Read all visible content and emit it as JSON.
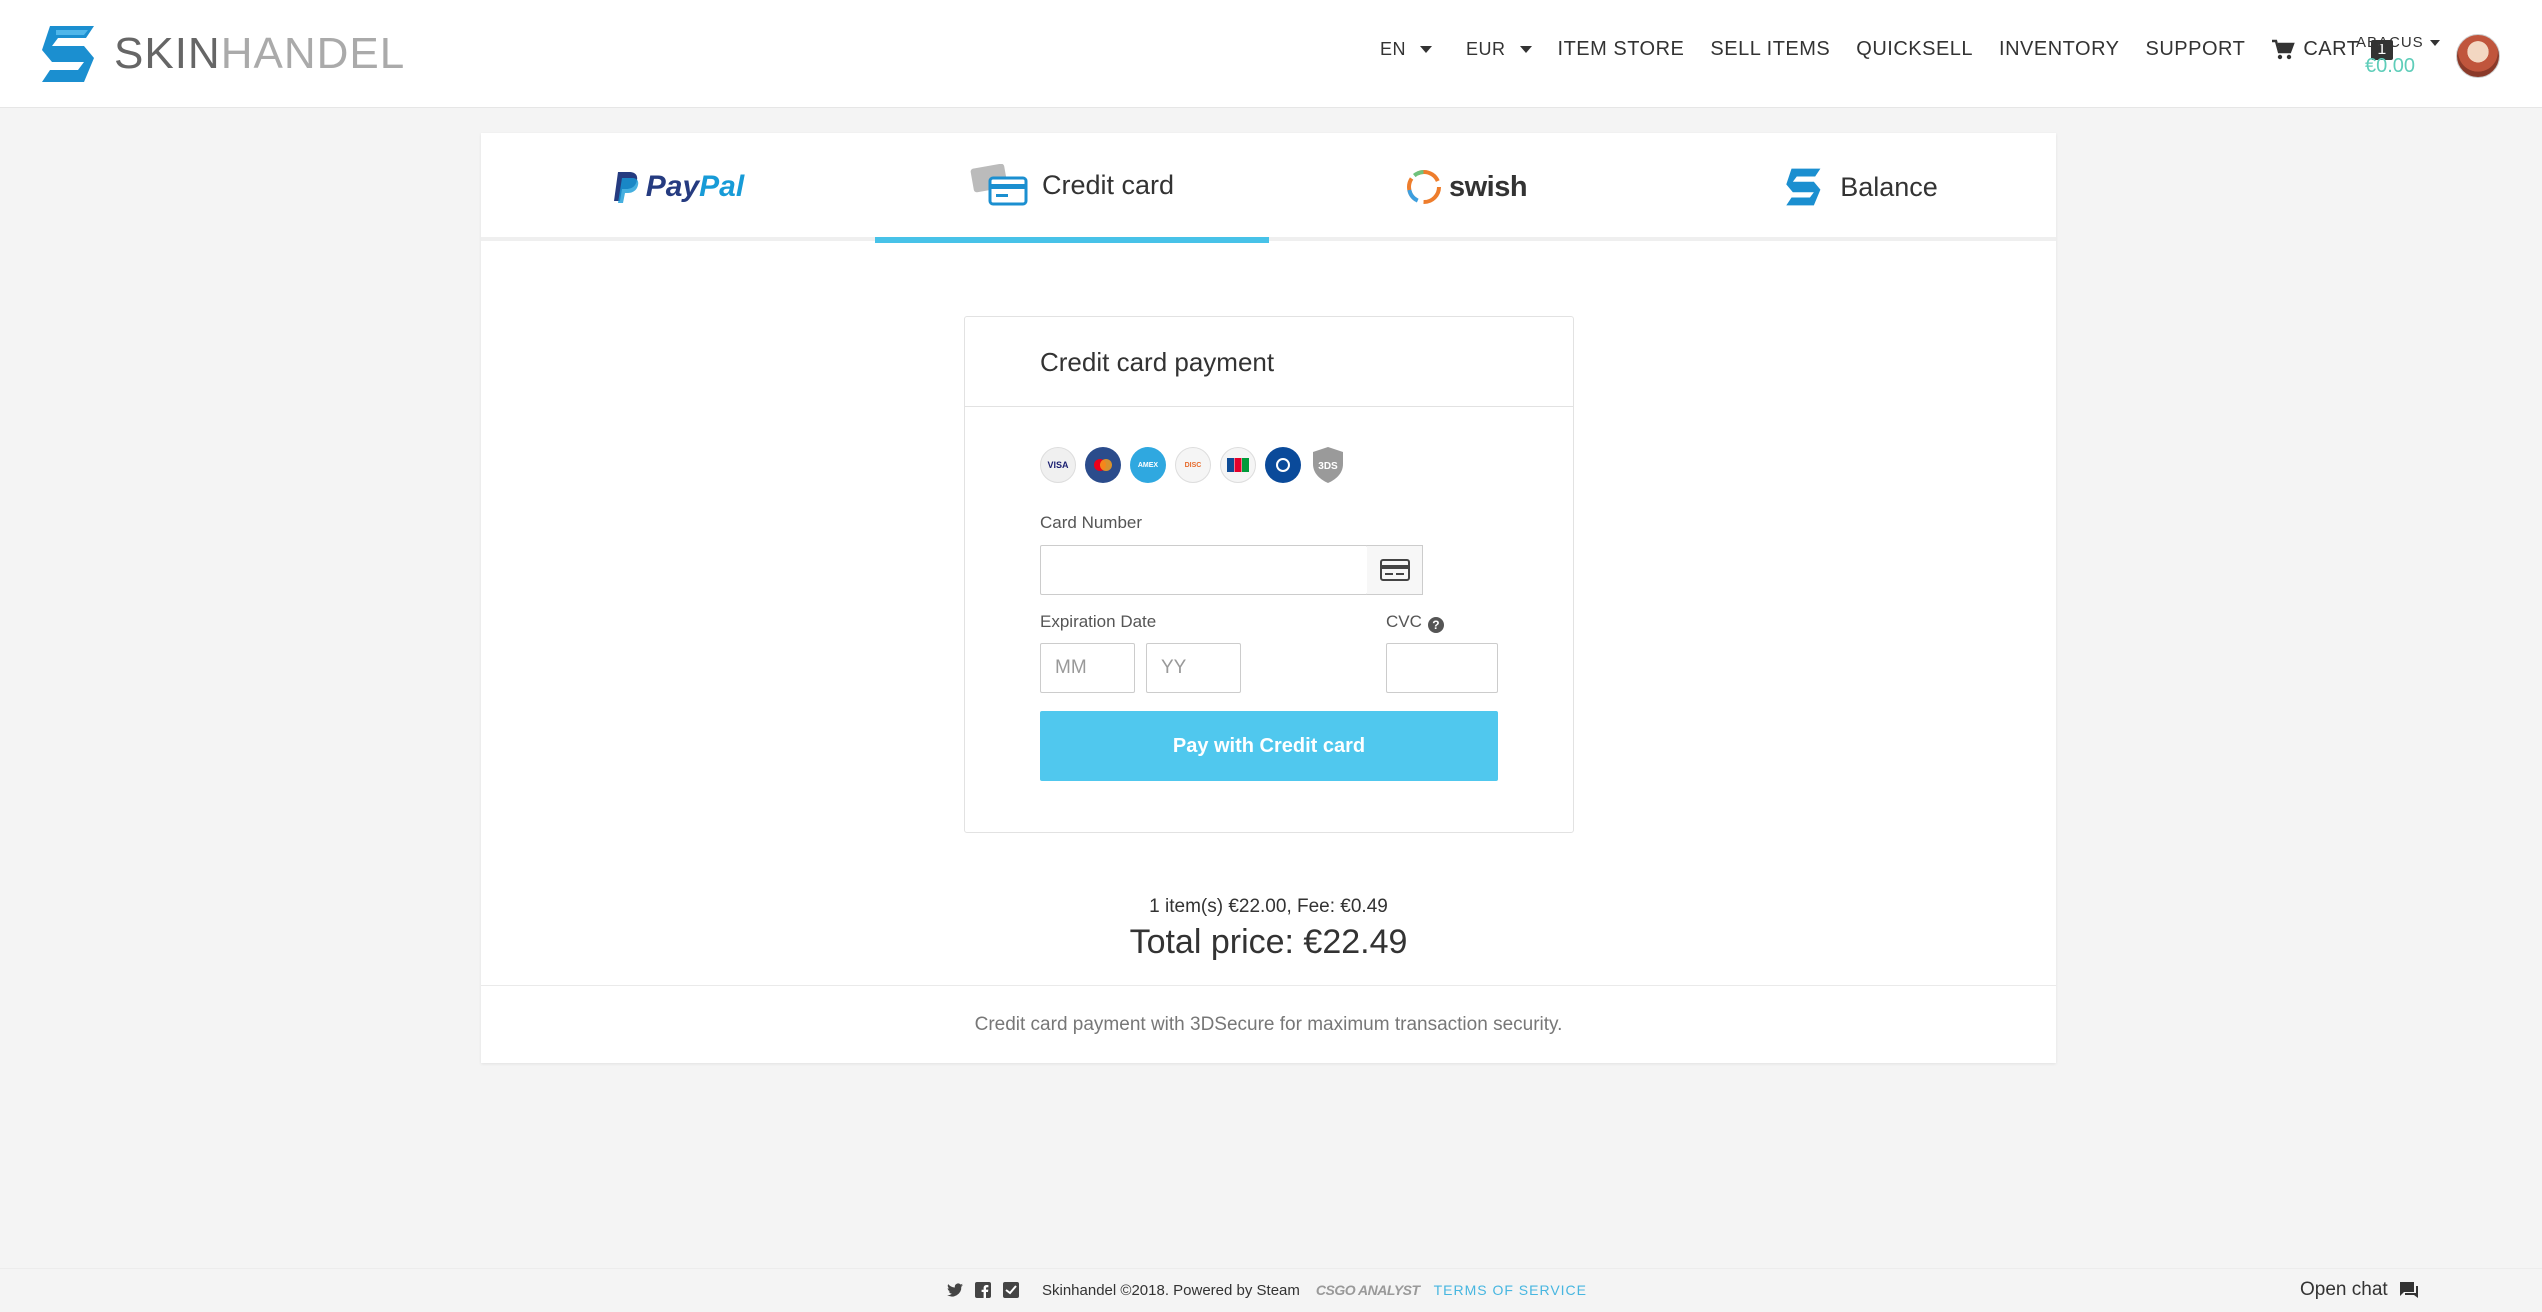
{
  "header": {
    "logo": {
      "part1": "SKIN",
      "part2": "HANDEL"
    },
    "language": "EN",
    "currency": "EUR",
    "nav": [
      "ITEM STORE",
      "SELL ITEMS",
      "QUICKSELL",
      "INVENTORY",
      "SUPPORT"
    ],
    "cart_label": "CART",
    "cart_count": "1",
    "user": {
      "name": "ABACUS",
      "balance": "€0.00"
    }
  },
  "tabs": [
    {
      "label": "PayPal",
      "icon": "paypal-logo"
    },
    {
      "label": "Credit card",
      "icon": "credit-card-icon",
      "active": true
    },
    {
      "label": "swish",
      "icon": "swish-logo"
    },
    {
      "label": "Balance",
      "icon": "skinhandel-logo"
    }
  ],
  "payment": {
    "title": "Credit card payment",
    "card_logos": [
      "VISA",
      "MasterCard",
      "American Express",
      "Discover",
      "JCB",
      "Diners Club",
      "3DS"
    ],
    "card_number_label": "Card Number",
    "card_number_value": "",
    "expiration_label": "Expiration Date",
    "month_placeholder": "MM",
    "year_placeholder": "YY",
    "cvc_label": "CVC",
    "cvc_value": "",
    "submit_label": "Pay with Credit card"
  },
  "summary": {
    "items_line": "1 item(s) €22.00, Fee: €0.49",
    "total_line": "Total price: €22.49",
    "security_note": "Credit card payment with 3DSecure for maximum transaction security."
  },
  "footer": {
    "copyright": "Skinhandel ©2018. Powered by Steam",
    "partner": "CSGO ANALYST",
    "terms": "TERMS OF SERVICE",
    "chat": "Open chat"
  },
  "colors": {
    "accent": "#47c2e8",
    "button": "#50c8ee",
    "balance": "#5ecdb9"
  }
}
